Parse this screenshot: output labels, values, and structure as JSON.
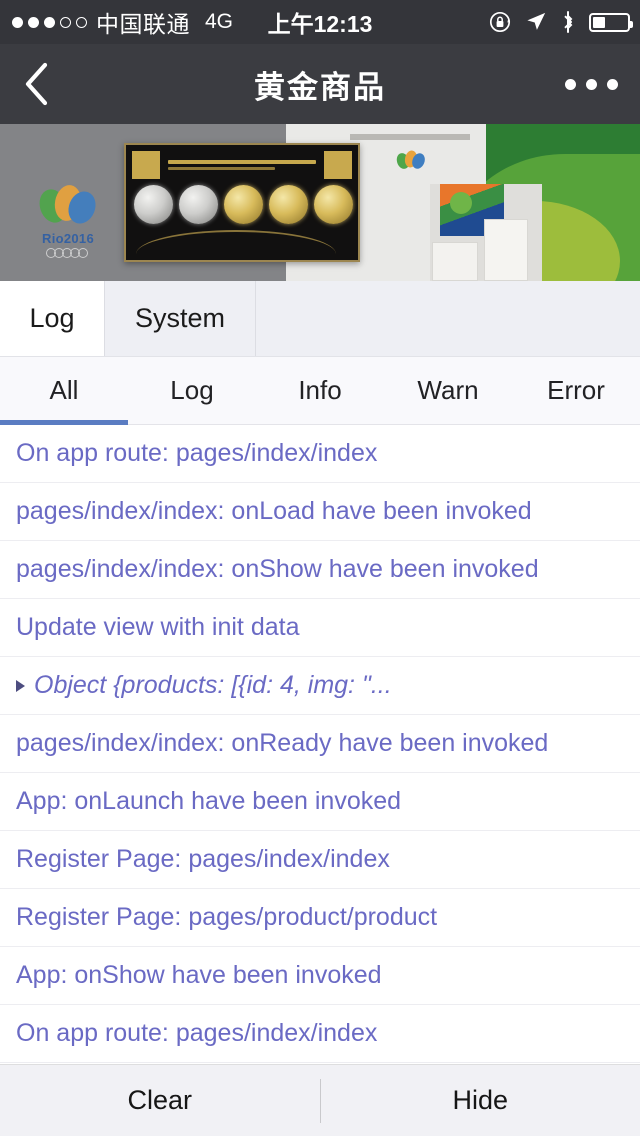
{
  "statusbar": {
    "signal_dots_filled": 3,
    "signal_dots_empty": 2,
    "carrier": "中国联通",
    "network": "4G",
    "time": "上午12:13",
    "icons": [
      "rotation-lock-icon",
      "location-arrow-icon",
      "bluetooth-icon",
      "battery-icon"
    ],
    "battery_percent": 35
  },
  "navbar": {
    "back_label": "‹",
    "title": "黄金商品",
    "more_label": "•••"
  },
  "banner": {
    "alt": "Rio 2016 Olympic gold coin commemorative product set",
    "brand": "Rio2016"
  },
  "console": {
    "main_tabs": [
      {
        "label": "Log",
        "active": true
      },
      {
        "label": "System",
        "active": false
      }
    ],
    "filter_tabs": [
      {
        "label": "All",
        "active": true
      },
      {
        "label": "Log",
        "active": false
      },
      {
        "label": "Info",
        "active": false
      },
      {
        "label": "Warn",
        "active": false
      },
      {
        "label": "Error",
        "active": false
      }
    ],
    "accent_color": "#5a7cc2",
    "log_text_color": "#6a6ac4",
    "entries": [
      {
        "text": "On app route: pages/index/index",
        "object": false
      },
      {
        "text": "pages/index/index: onLoad have been invoked",
        "object": false
      },
      {
        "text": "pages/index/index: onShow have been invoked",
        "object": false
      },
      {
        "text": "Update view with init data",
        "object": false
      },
      {
        "text": "Object {products: [{id: 4, img: \"...",
        "object": true
      },
      {
        "text": "pages/index/index: onReady have been invoked",
        "object": false
      },
      {
        "text": "App: onLaunch have been invoked",
        "object": false
      },
      {
        "text": "Register Page: pages/index/index",
        "object": false
      },
      {
        "text": "Register Page: pages/product/product",
        "object": false
      },
      {
        "text": "App: onShow have been invoked",
        "object": false
      },
      {
        "text": "On app route: pages/index/index",
        "object": false
      }
    ],
    "footer": {
      "clear_label": "Clear",
      "hide_label": "Hide"
    }
  }
}
